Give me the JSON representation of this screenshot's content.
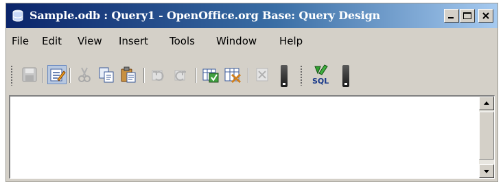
{
  "window": {
    "title": "Sample.odb : Query1 - OpenOffice.org Base: Query Design",
    "controls": {
      "minimize": "minimize",
      "maximize": "maximize",
      "close": "close"
    }
  },
  "menubar": {
    "items": [
      {
        "label": "File"
      },
      {
        "label": "Edit"
      },
      {
        "label": "View"
      },
      {
        "label": "Insert"
      },
      {
        "label": "Tools"
      },
      {
        "label": "Window"
      },
      {
        "label": "Help"
      }
    ]
  },
  "toolbar": {
    "buttons": [
      {
        "icon": "save-icon",
        "enabled": false
      },
      {
        "icon": "edit-mode-icon",
        "enabled": true,
        "pressed": true
      },
      {
        "icon": "cut-icon",
        "enabled": false
      },
      {
        "icon": "copy-icon",
        "enabled": true
      },
      {
        "icon": "paste-icon",
        "enabled": true
      },
      {
        "icon": "undo-icon",
        "enabled": false
      },
      {
        "icon": "redo-icon",
        "enabled": false
      },
      {
        "icon": "run-query-icon",
        "enabled": true
      },
      {
        "icon": "clear-query-icon",
        "enabled": true
      },
      {
        "icon": "delete-icon",
        "enabled": false
      },
      {
        "icon": "sql-icon",
        "enabled": true,
        "text": "SQL"
      }
    ]
  },
  "editor": {
    "content": ""
  },
  "colors": {
    "titlebar_start": "#0a246a",
    "titlebar_end": "#a6caf0",
    "chrome": "#d4d0c8"
  }
}
